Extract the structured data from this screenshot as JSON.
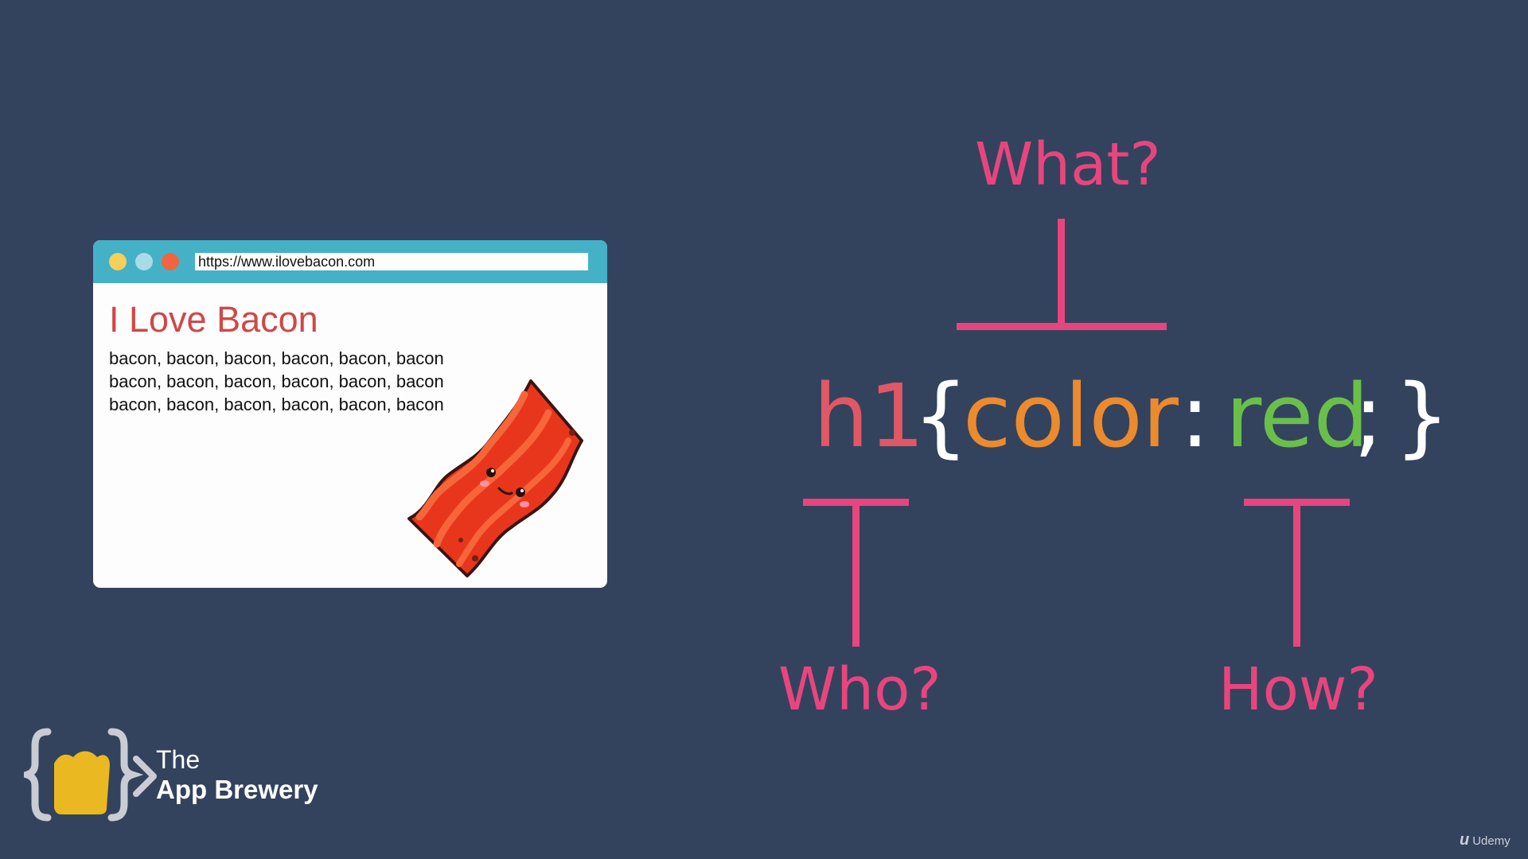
{
  "browser": {
    "url": "https://www.ilovebacon.com",
    "title": "I Love Bacon",
    "lines": [
      "bacon, bacon, bacon, bacon, bacon, bacon",
      "bacon, bacon, bacon, bacon, bacon, bacon",
      "bacon, bacon, bacon, bacon, bacon, bacon"
    ]
  },
  "diagram": {
    "what": "What?",
    "who": "Who?",
    "how": "How?",
    "code": {
      "selector": "h1",
      "open_brace": "{",
      "property": "color",
      "colon": ":",
      "value": "red",
      "semicolon": ";",
      "close_brace": "}"
    }
  },
  "branding": {
    "line1": "The",
    "line2": "App Brewery"
  },
  "watermark": {
    "mark": "u",
    "text": "Udemy"
  },
  "colors": {
    "background": "#33435e",
    "label_pink": "#e8457e",
    "selector_red": "#e05766",
    "property_orange": "#ec8a2e",
    "value_green": "#6abf4b",
    "browser_bar": "#45b1c6",
    "page_title": "#d04747"
  }
}
